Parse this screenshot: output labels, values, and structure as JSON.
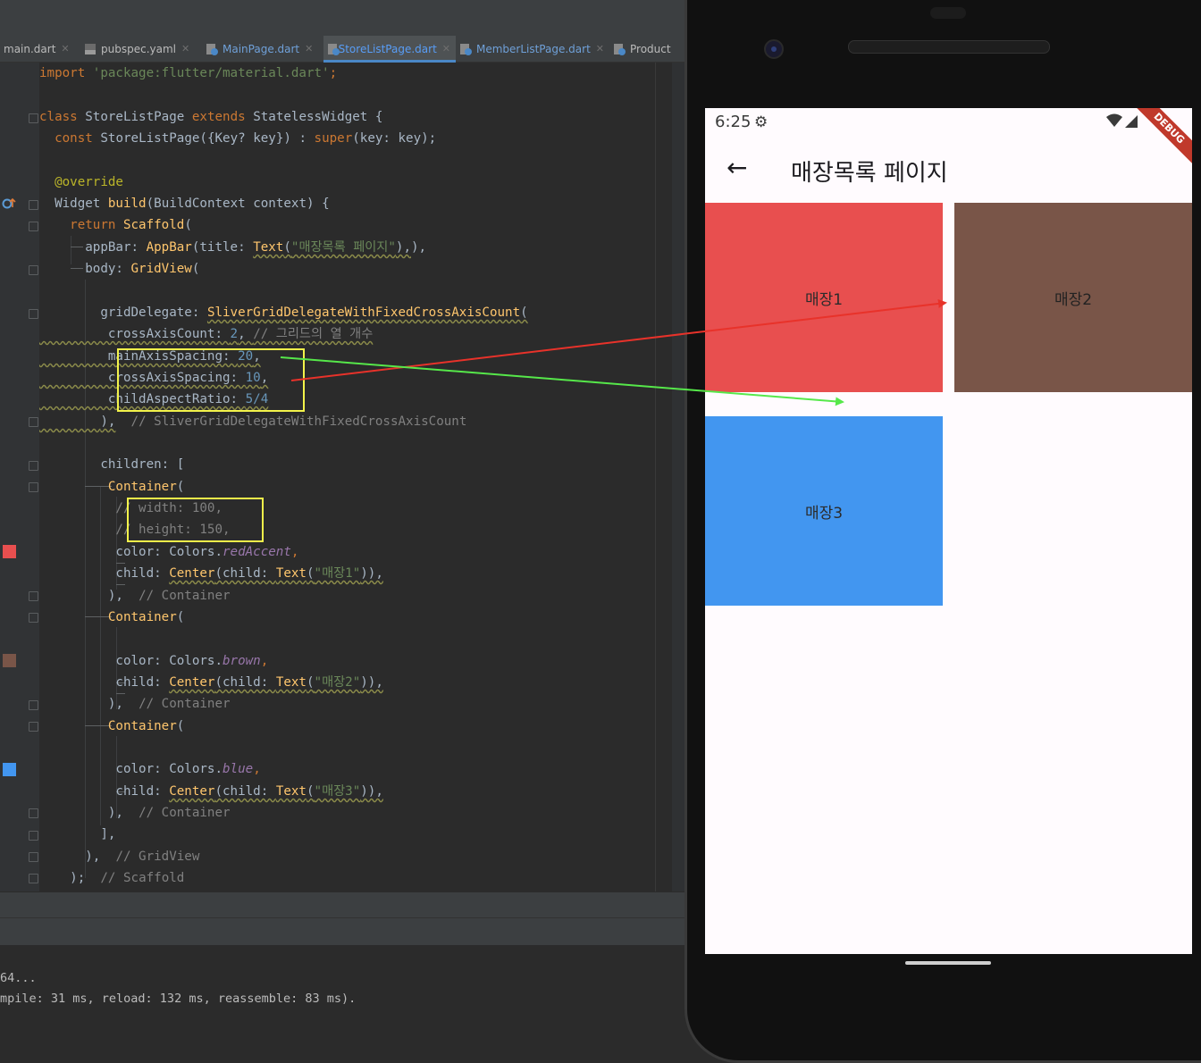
{
  "ide": {
    "tabs": [
      {
        "label": "main.dart",
        "icon": "dart-file-icon",
        "active": false
      },
      {
        "label": "pubspec.yaml",
        "icon": "yaml-file-icon",
        "active": false
      },
      {
        "label": "MainPage.dart",
        "icon": "dart-file-icon",
        "active": false
      },
      {
        "label": "StoreListPage.dart",
        "icon": "dart-file-icon",
        "active": true
      },
      {
        "label": "MemberListPage.dart",
        "icon": "dart-file-icon",
        "active": false
      },
      {
        "label": "Product",
        "icon": "dart-file-icon",
        "active": false
      }
    ],
    "code": {
      "l1_import": "import",
      "l1_str": "'package:flutter/material.dart'",
      "l1_end": ";",
      "l3_class": "class",
      "l3_name": "StoreListPage",
      "l3_extends": "extends",
      "l3_rest": "StatelessWidget {",
      "l4_const": "const",
      "l4_a": "StoreListPage({Key? key}) : ",
      "l4_super": "super",
      "l4_b": "(key: key);",
      "l6_override": "@override",
      "l7_a": "Widget ",
      "l7_build": "build",
      "l7_b": "(BuildContext context) {",
      "l8_return": "return",
      "l8_scaffold": "Scaffold",
      "l8_paren": "(",
      "l9_a": "appBar: ",
      "l9_appbar": "AppBar",
      "l9_b": "(title: ",
      "l9_text": "Text",
      "l9_c": "(",
      "l9_str": "\"매장목록 페이지\"",
      "l9_d": "),",
      "l9_e": "),",
      "l10_a": "body: ",
      "l10_grid": "GridView",
      "l10_b": "(",
      "l12_a": "gridDelegate: ",
      "l12_cls": "SliverGridDelegateWithFixedCrossAxisCount",
      "l12_b": "(",
      "l13_a": "crossAxisCount: ",
      "l13_num": "2",
      "l13_b": ", ",
      "l13_com": "// 그리드의 열 개수",
      "l14_a": "mainAxisSpacing: ",
      "l14_num": "20",
      "l14_b": ",",
      "l15_a": "crossAxisSpacing: ",
      "l15_num": "10",
      "l15_b": ",",
      "l16_a": "childAspectRatio: ",
      "l16_num": "5/4",
      "l17_a": "),",
      "l17_com": "// SliverGridDelegateWithFixedCrossAxisCount",
      "l19_a": "children: [",
      "l20_container": "Container",
      "l20_b": "(",
      "l21_com": "// width: 100,",
      "l22_com": "// height: 150,",
      "l23_a": "color: Colors.",
      "l23_prop": "redAccent",
      "l23_b": ",",
      "l24_a": "child: ",
      "l24_center": "Center",
      "l24_b": "(child: ",
      "l24_text": "Text",
      "l24_c": "(",
      "l24_str": "\"매장1\"",
      "l24_d": ")),",
      "l25_a": "),",
      "l25_com": "// Container",
      "l26_container": "Container",
      "l26_b": "(",
      "l28_a": "color: Colors.",
      "l28_prop": "brown",
      "l28_b": ",",
      "l29_a": "child: ",
      "l29_center": "Center",
      "l29_b": "(child: ",
      "l29_text": "Text",
      "l29_c": "(",
      "l29_str": "\"매장2\"",
      "l29_d": ")),",
      "l30_a": "),",
      "l30_com": "// Container",
      "l31_container": "Container",
      "l31_b": "(",
      "l33_a": "color: Colors.",
      "l33_prop": "blue",
      "l33_b": ",",
      "l34_a": "child: ",
      "l34_center": "Center",
      "l34_b": "(child: ",
      "l34_text": "Text",
      "l34_c": "(",
      "l34_str": "\"매장3\"",
      "l34_d": ")),",
      "l35_a": "),",
      "l35_com": "// Container",
      "l36_a": "],",
      "l37_a": "),",
      "l37_com": "// GridView",
      "l38_a": ");",
      "l38_com": "// Scaffold"
    },
    "gutter_swatches": {
      "red": "#e84f4f",
      "brown": "#795548",
      "blue": "#4296f0"
    },
    "console": {
      "line1": "64...",
      "line2": "mpile: 31 ms, reload: 132 ms, reassemble: 83 ms)."
    }
  },
  "phone": {
    "status_time": "6:25",
    "debug_banner": "DEBUG",
    "app_title": "매장목록 페이지",
    "tiles": [
      {
        "label": "매장1",
        "color": "#e84f4f"
      },
      {
        "label": "매장2",
        "color": "#795548"
      },
      {
        "label": "매장3",
        "color": "#4296f0"
      }
    ]
  },
  "annotations": {
    "highlight_color": "#f3f34a",
    "arrow_red": "#e8322a",
    "arrow_green": "#56e84a"
  }
}
